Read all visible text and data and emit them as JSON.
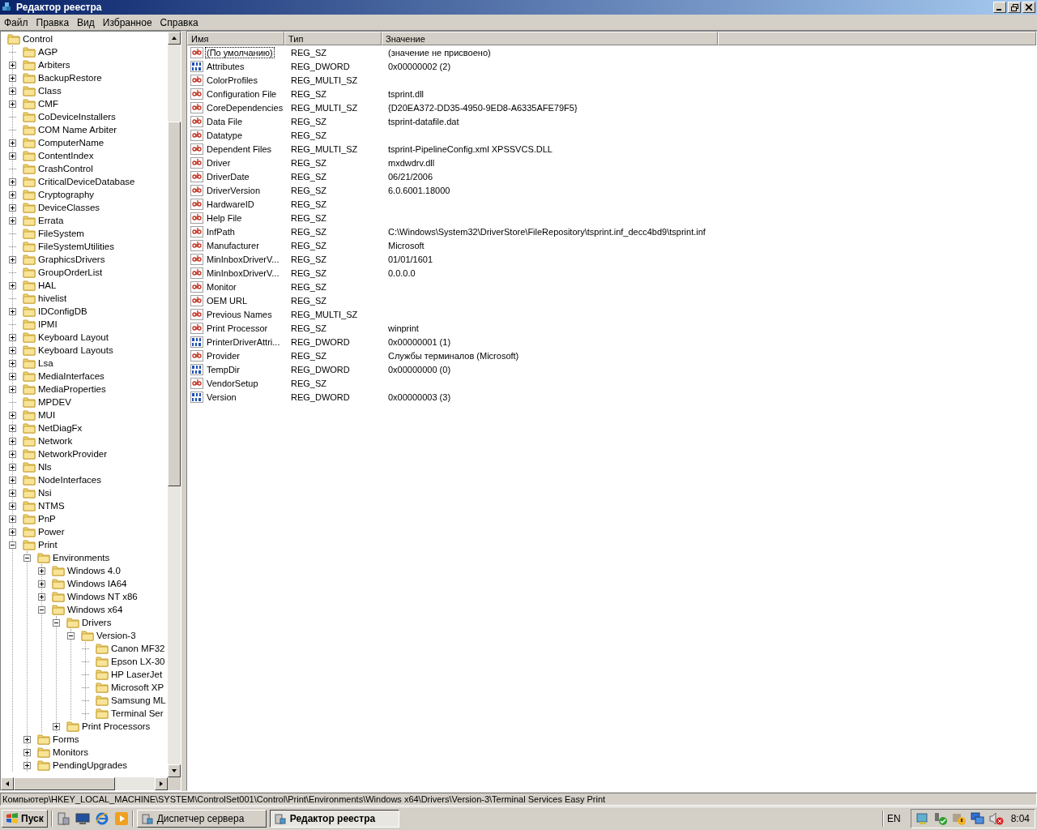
{
  "window": {
    "title": "Редактор реестра"
  },
  "menu": [
    "Файл",
    "Правка",
    "Вид",
    "Избранное",
    "Справка"
  ],
  "tree": [
    {
      "label": "Control",
      "children": [
        {
          "label": "AGP"
        },
        {
          "label": "Arbiters",
          "expanded": false
        },
        {
          "label": "BackupRestore",
          "expanded": false
        },
        {
          "label": "Class",
          "expanded": false
        },
        {
          "label": "CMF",
          "expanded": false
        },
        {
          "label": "CoDeviceInstallers"
        },
        {
          "label": "COM Name Arbiter"
        },
        {
          "label": "ComputerName",
          "expanded": false
        },
        {
          "label": "ContentIndex",
          "expanded": false
        },
        {
          "label": "CrashControl"
        },
        {
          "label": "CriticalDeviceDatabase",
          "expanded": false
        },
        {
          "label": "Cryptography",
          "expanded": false
        },
        {
          "label": "DeviceClasses",
          "expanded": false
        },
        {
          "label": "Errata",
          "expanded": false
        },
        {
          "label": "FileSystem"
        },
        {
          "label": "FileSystemUtilities"
        },
        {
          "label": "GraphicsDrivers",
          "expanded": false
        },
        {
          "label": "GroupOrderList"
        },
        {
          "label": "HAL",
          "expanded": false
        },
        {
          "label": "hivelist"
        },
        {
          "label": "IDConfigDB",
          "expanded": false
        },
        {
          "label": "IPMI"
        },
        {
          "label": "Keyboard Layout",
          "expanded": false
        },
        {
          "label": "Keyboard Layouts",
          "expanded": false
        },
        {
          "label": "Lsa",
          "expanded": false
        },
        {
          "label": "MediaInterfaces",
          "expanded": false
        },
        {
          "label": "MediaProperties",
          "expanded": false
        },
        {
          "label": "MPDEV"
        },
        {
          "label": "MUI",
          "expanded": false
        },
        {
          "label": "NetDiagFx",
          "expanded": false
        },
        {
          "label": "Network",
          "expanded": false
        },
        {
          "label": "NetworkProvider",
          "expanded": false
        },
        {
          "label": "Nls",
          "expanded": false
        },
        {
          "label": "NodeInterfaces",
          "expanded": false
        },
        {
          "label": "Nsi",
          "expanded": false
        },
        {
          "label": "NTMS",
          "expanded": false
        },
        {
          "label": "PnP",
          "expanded": false
        },
        {
          "label": "Power",
          "expanded": false
        },
        {
          "label": "Print",
          "expanded": true,
          "children": [
            {
              "label": "Environments",
              "expanded": true,
              "children": [
                {
                  "label": "Windows 4.0",
                  "expanded": false
                },
                {
                  "label": "Windows IA64",
                  "expanded": false
                },
                {
                  "label": "Windows NT x86",
                  "expanded": false
                },
                {
                  "label": "Windows x64",
                  "expanded": true,
                  "children": [
                    {
                      "label": "Drivers",
                      "expanded": true,
                      "children": [
                        {
                          "label": "Version-3",
                          "expanded": true,
                          "children": [
                            {
                              "label": "Canon MF32"
                            },
                            {
                              "label": "Epson LX-30"
                            },
                            {
                              "label": "HP LaserJet"
                            },
                            {
                              "label": "Microsoft XP"
                            },
                            {
                              "label": "Samsung ML"
                            },
                            {
                              "label": "Terminal Ser"
                            }
                          ]
                        }
                      ]
                    },
                    {
                      "label": "Print Processors",
                      "expanded": false
                    }
                  ]
                }
              ]
            },
            {
              "label": "Forms",
              "expanded": false
            },
            {
              "label": "Monitors",
              "expanded": false
            },
            {
              "label": "PendingUpgrades",
              "expanded": false
            }
          ]
        }
      ]
    }
  ],
  "table": {
    "columns": [
      "Имя",
      "Тип",
      "Значение"
    ],
    "rows": [
      {
        "kind": "sz",
        "name": "(По умолчанию)",
        "type": "REG_SZ",
        "value": "(значение не присвоено)",
        "focused": true
      },
      {
        "kind": "dword",
        "name": "Attributes",
        "type": "REG_DWORD",
        "value": "0x00000002 (2)",
        "focused": false
      },
      {
        "kind": "sz",
        "name": "ColorProfiles",
        "type": "REG_MULTI_SZ",
        "focused": false
      },
      {
        "kind": "sz",
        "name": "Configuration File",
        "type": "REG_SZ",
        "value": "tsprint.dll",
        "focused": false
      },
      {
        "kind": "sz",
        "name": "CoreDependencies",
        "type": "REG_MULTI_SZ",
        "value": "{D20EA372-DD35-4950-9ED8-A6335AFE79F5}",
        "focused": false
      },
      {
        "kind": "sz",
        "name": "Data File",
        "type": "REG_SZ",
        "value": "tsprint-datafile.dat",
        "focused": false
      },
      {
        "kind": "sz",
        "name": "Datatype",
        "type": "REG_SZ",
        "focused": false
      },
      {
        "kind": "sz",
        "name": "Dependent Files",
        "type": "REG_MULTI_SZ",
        "value": "tsprint-PipelineConfig.xml XPSSVCS.DLL",
        "focused": false
      },
      {
        "kind": "sz",
        "name": "Driver",
        "type": "REG_SZ",
        "value": "mxdwdrv.dll",
        "focused": false
      },
      {
        "kind": "sz",
        "name": "DriverDate",
        "type": "REG_SZ",
        "value": "06/21/2006",
        "focused": false
      },
      {
        "kind": "sz",
        "name": "DriverVersion",
        "type": "REG_SZ",
        "value": "6.0.6001.18000",
        "focused": false
      },
      {
        "kind": "sz",
        "name": "HardwareID",
        "type": "REG_SZ",
        "focused": false
      },
      {
        "kind": "sz",
        "name": "Help File",
        "type": "REG_SZ",
        "focused": false
      },
      {
        "kind": "sz",
        "name": "InfPath",
        "type": "REG_SZ",
        "value": "C:\\Windows\\System32\\DriverStore\\FileRepository\\tsprint.inf_decc4bd9\\tsprint.inf",
        "focused": false
      },
      {
        "kind": "sz",
        "name": "Manufacturer",
        "type": "REG_SZ",
        "value": "Microsoft",
        "focused": false
      },
      {
        "kind": "sz",
        "name": "MinInboxDriverV...",
        "type": "REG_SZ",
        "value": "01/01/1601",
        "focused": false
      },
      {
        "kind": "sz",
        "name": "MinInboxDriverV...",
        "type": "REG_SZ",
        "value": "0.0.0.0",
        "focused": false
      },
      {
        "kind": "sz",
        "name": "Monitor",
        "type": "REG_SZ",
        "focused": false
      },
      {
        "kind": "sz",
        "name": "OEM URL",
        "type": "REG_SZ",
        "focused": false
      },
      {
        "kind": "sz",
        "name": "Previous Names",
        "type": "REG_MULTI_SZ",
        "focused": false
      },
      {
        "kind": "sz",
        "name": "Print Processor",
        "type": "REG_SZ",
        "value": "winprint",
        "focused": false
      },
      {
        "kind": "dword",
        "name": "PrinterDriverAttri...",
        "type": "REG_DWORD",
        "value": "0x00000001 (1)",
        "focused": false
      },
      {
        "kind": "sz",
        "name": "Provider",
        "type": "REG_SZ",
        "value": "Службы терминалов (Microsoft)",
        "focused": false
      },
      {
        "kind": "dword",
        "name": "TempDir",
        "type": "REG_DWORD",
        "value": "0x00000000 (0)",
        "focused": false
      },
      {
        "kind": "sz",
        "name": "VendorSetup",
        "type": "REG_SZ",
        "focused": false
      },
      {
        "kind": "dword",
        "name": "Version",
        "type": "REG_DWORD",
        "value": "0x00000003 (3)",
        "focused": false
      }
    ]
  },
  "status_bar": "Компьютер\\HKEY_LOCAL_MACHINE\\SYSTEM\\ControlSet001\\Control\\Print\\Environments\\Windows x64\\Drivers\\Version-3\\Terminal Services Easy Print",
  "taskbar": {
    "start": "Пуск",
    "tasks": [
      {
        "label": "Диспетчер сервера",
        "selected": false
      },
      {
        "label": "Редактор реестра",
        "selected": true
      }
    ],
    "language": "EN",
    "clock": "8:04"
  }
}
